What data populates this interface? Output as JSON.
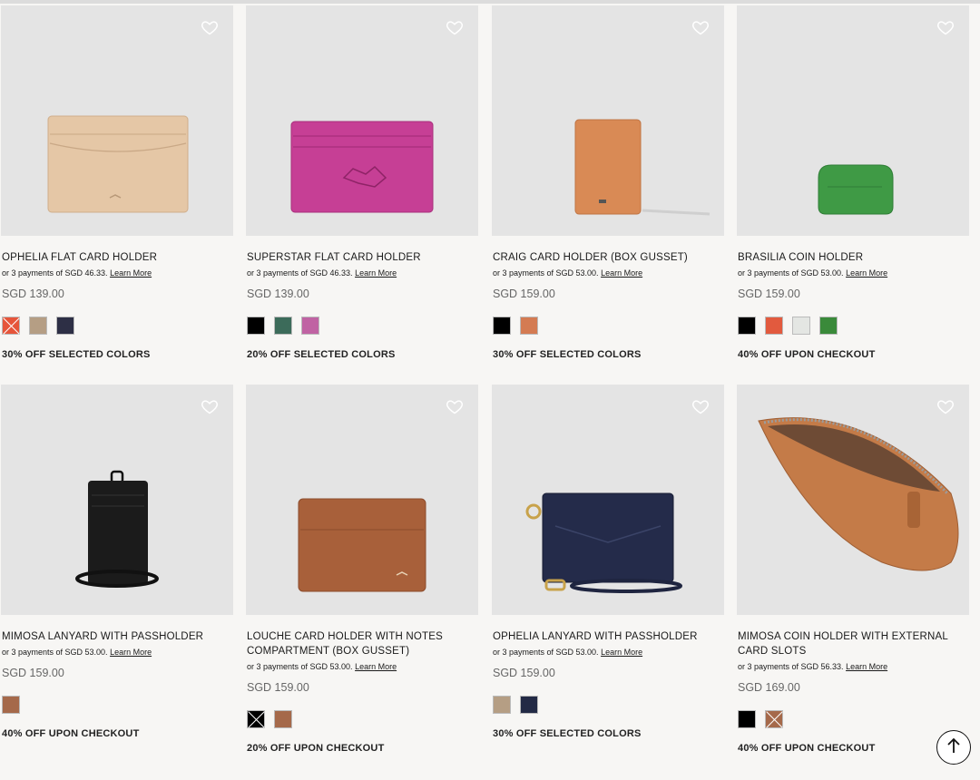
{
  "products": [
    {
      "name": "OPHELIA FLAT CARD HOLDER",
      "payment_prefix": "or 3 payments of SGD 46.33.",
      "learn_more": "Learn More",
      "price": "SGD 139.00",
      "swatches": [
        "#e6553a",
        "#b59e84",
        "#2d2f45"
      ],
      "crossed": [
        0
      ],
      "promo": "30% OFF SELECTED COLORS",
      "image": "beige-card-holder"
    },
    {
      "name": "SUPERSTAR FLAT CARD HOLDER",
      "payment_prefix": "or 3 payments of SGD 46.33.",
      "learn_more": "Learn More",
      "price": "SGD 139.00",
      "swatches": [
        "#000000",
        "#3c6b5a",
        "#c063a3"
      ],
      "crossed": [],
      "promo": "20% OFF SELECTED COLORS",
      "image": "magenta-card-holder"
    },
    {
      "name": "CRAIG CARD HOLDER (BOX GUSSET)",
      "payment_prefix": "or 3 payments of SGD 53.00.",
      "learn_more": "Learn More",
      "price": "SGD 159.00",
      "swatches": [
        "#000000",
        "#d47b52"
      ],
      "crossed": [],
      "promo": "30% OFF SELECTED COLORS",
      "image": "orange-card-holder"
    },
    {
      "name": "BRASILIA COIN HOLDER",
      "payment_prefix": "or 3 payments of SGD 53.00.",
      "learn_more": "Learn More",
      "price": "SGD 159.00",
      "swatches": [
        "#000000",
        "#e25a3e",
        "#e4e6e3",
        "#3a8a3a"
      ],
      "crossed": [],
      "promo": "40% OFF UPON CHECKOUT",
      "image": "green-coin-holder"
    },
    {
      "name": "MIMOSA LANYARD WITH PASSHOLDER",
      "payment_prefix": "or 3 payments of SGD 53.00.",
      "learn_more": "Learn More",
      "price": "SGD 159.00",
      "swatches": [
        "#a5694a"
      ],
      "crossed": [],
      "promo": "40% OFF UPON CHECKOUT",
      "image": "black-lanyard"
    },
    {
      "name": "LOUCHE CARD HOLDER WITH NOTES COMPARTMENT (BOX GUSSET)",
      "payment_prefix": "or 3 payments of SGD 53.00.",
      "learn_more": "Learn More",
      "price": "SGD 159.00",
      "swatches": [
        "#000000",
        "#a5694a"
      ],
      "crossed": [
        0
      ],
      "promo": "20% OFF UPON CHECKOUT",
      "image": "brown-card-holder"
    },
    {
      "name": "OPHELIA LANYARD WITH PASSHOLDER",
      "payment_prefix": "or 3 payments of SGD 53.00.",
      "learn_more": "Learn More",
      "price": "SGD 159.00",
      "swatches": [
        "#b59e84",
        "#232a45"
      ],
      "crossed": [],
      "promo": "30% OFF SELECTED COLORS",
      "image": "navy-lanyard"
    },
    {
      "name": "MIMOSA COIN HOLDER WITH EXTERNAL CARD SLOTS",
      "payment_prefix": "or 3 payments of SGD 56.33.",
      "learn_more": "Learn More",
      "price": "SGD 169.00",
      "swatches": [
        "#000000",
        "#a5694a"
      ],
      "crossed": [
        1
      ],
      "promo": "40% OFF UPON CHECKOUT",
      "image": "tan-zip-pouch"
    }
  ],
  "scroll_top_icon": "arrow-up-icon",
  "heart_icon": "heart-icon"
}
